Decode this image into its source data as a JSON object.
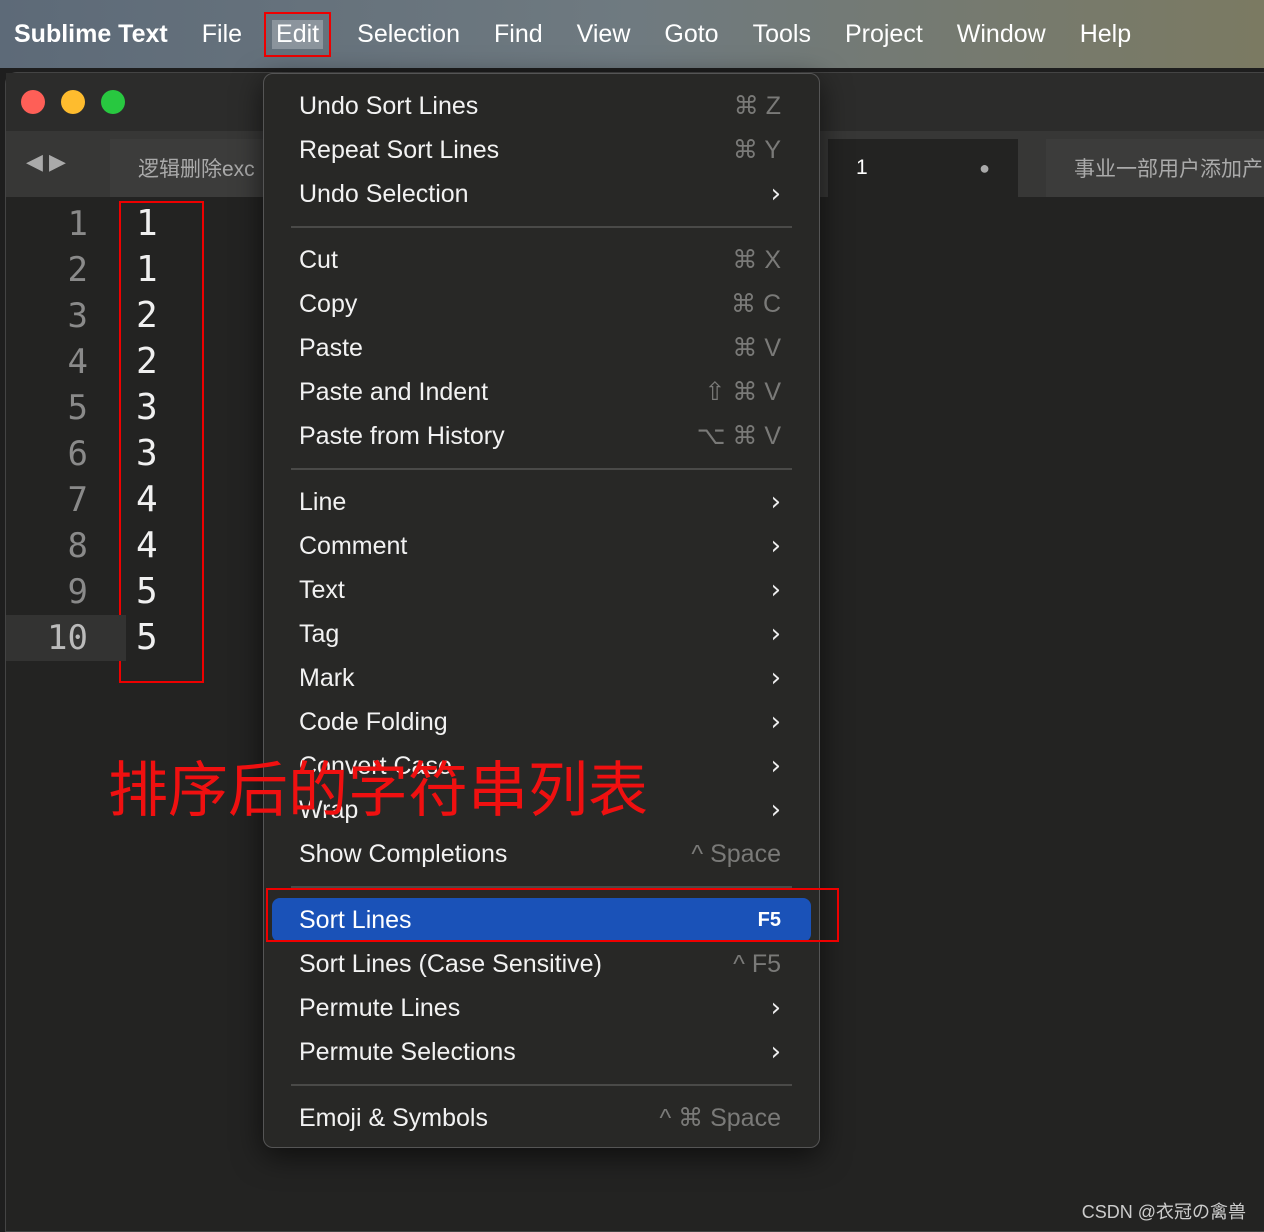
{
  "menubar": {
    "items": [
      "Sublime Text",
      "File",
      "Edit",
      "Selection",
      "Find",
      "View",
      "Goto",
      "Tools",
      "Project",
      "Window",
      "Help"
    ],
    "active": "Edit"
  },
  "window": {
    "traffic_lights": [
      "#fe5f57",
      "#febc2e",
      "#28c840"
    ]
  },
  "tabs": [
    {
      "label": "逻辑删除exc"
    },
    {
      "label": "1",
      "dirty": true
    },
    {
      "label": "事业一部用户添加产"
    }
  ],
  "editor": {
    "line_numbers": [
      "1",
      "2",
      "3",
      "4",
      "5",
      "6",
      "7",
      "8",
      "9",
      "10"
    ],
    "lines": [
      "1",
      "1",
      "2",
      "2",
      "3",
      "3",
      "4",
      "4",
      "5",
      "5"
    ],
    "current_line": 10
  },
  "annotation": "排序后的字符串列表",
  "menu": {
    "items": [
      {
        "label": "Undo Sort Lines",
        "shortcut": "⌘ Z"
      },
      {
        "label": "Repeat Sort Lines",
        "shortcut": "⌘ Y"
      },
      {
        "label": "Undo Selection",
        "submenu": true
      },
      {
        "separator": true
      },
      {
        "label": "Cut",
        "shortcut": "⌘ X"
      },
      {
        "label": "Copy",
        "shortcut": "⌘ C"
      },
      {
        "label": "Paste",
        "shortcut": "⌘ V"
      },
      {
        "label": "Paste and Indent",
        "shortcut": "⇧ ⌘ V"
      },
      {
        "label": "Paste from History",
        "shortcut": "⌥ ⌘ V"
      },
      {
        "separator": true
      },
      {
        "label": "Line",
        "submenu": true
      },
      {
        "label": "Comment",
        "submenu": true
      },
      {
        "label": "Text",
        "submenu": true
      },
      {
        "label": "Tag",
        "submenu": true
      },
      {
        "label": "Mark",
        "submenu": true
      },
      {
        "label": "Code Folding",
        "submenu": true
      },
      {
        "label": "Convert Case",
        "submenu": true
      },
      {
        "label": "Wrap",
        "submenu": true
      },
      {
        "label": "Show Completions",
        "shortcut": "^ Space"
      },
      {
        "separator": true
      },
      {
        "label": "Sort Lines",
        "shortcut": "F5",
        "highlighted": true
      },
      {
        "label": "Sort Lines (Case Sensitive)",
        "shortcut": "^ F5"
      },
      {
        "label": "Permute Lines",
        "submenu": true
      },
      {
        "label": "Permute Selections",
        "submenu": true
      },
      {
        "separator": true
      },
      {
        "label": "Emoji & Symbols",
        "shortcut": "^ ⌘ Space"
      }
    ]
  },
  "watermark": "CSDN @衣冠の禽兽"
}
